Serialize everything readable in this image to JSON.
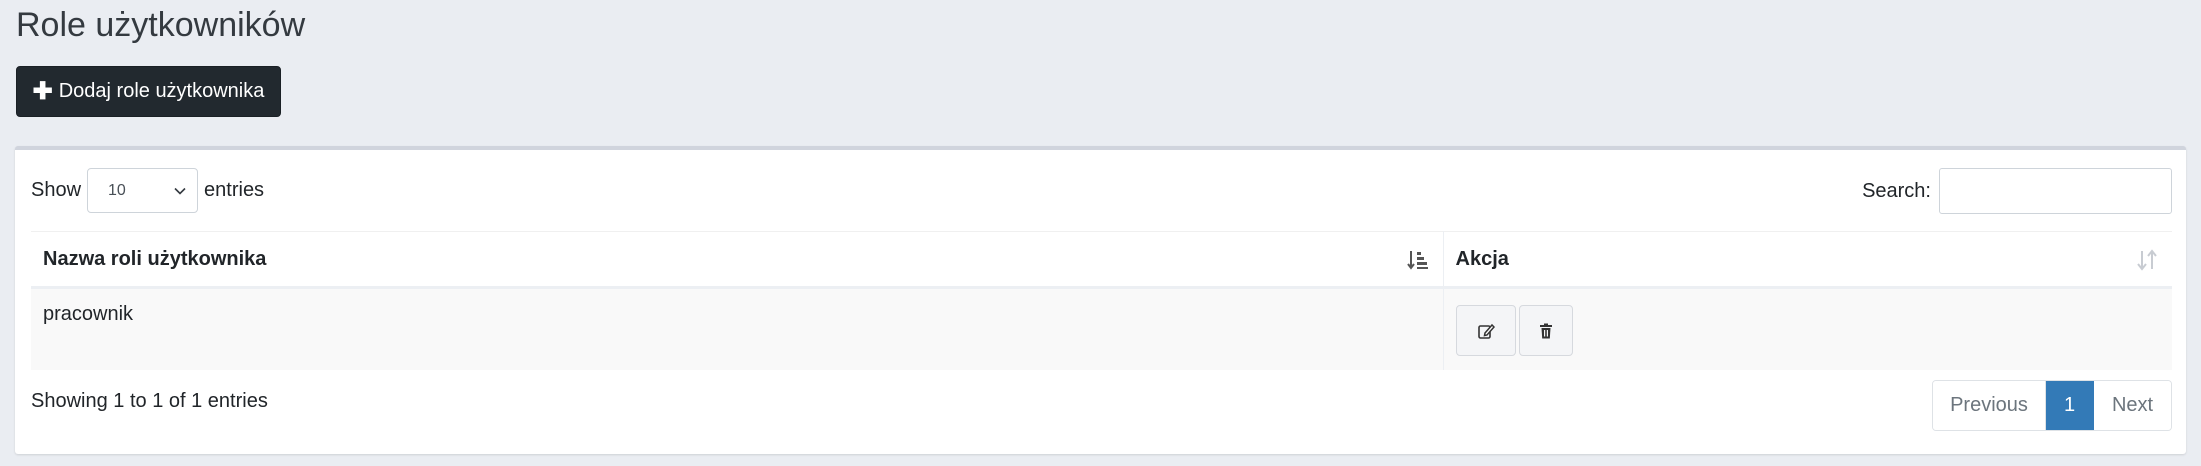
{
  "page": {
    "title": "Role użytkowników",
    "add_button_label": "Dodaj role użytkownika"
  },
  "length": {
    "prefix": "Show",
    "value": "10",
    "suffix": "entries"
  },
  "search": {
    "label": "Search:",
    "value": ""
  },
  "table": {
    "columns": [
      "Nazwa roli użytkownika",
      "Akcja"
    ],
    "rows": [
      {
        "name": "pracownik"
      }
    ]
  },
  "footer": {
    "info": "Showing 1 to 1 of 1 entries",
    "previous": "Previous",
    "current_page": "1",
    "next": "Next"
  },
  "colors": {
    "background": "#eaedf2",
    "dark_button": "#22292f",
    "active_page": "#337ab7"
  }
}
